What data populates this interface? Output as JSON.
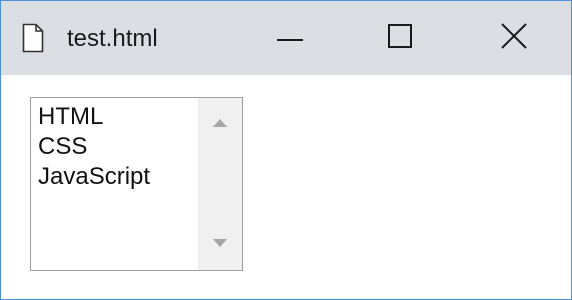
{
  "window": {
    "title": "test.html",
    "icons": {
      "document": "document-icon",
      "minimize": "minimize-icon",
      "maximize": "maximize-icon",
      "close": "close-icon"
    }
  },
  "listbox": {
    "options": [
      "HTML",
      "CSS",
      "JavaScript"
    ],
    "scrollbar": {
      "up_icon": "scroll-up-arrow-icon",
      "down_icon": "scroll-down-arrow-icon"
    }
  },
  "colors": {
    "titlebar_bg": "#dbdfe4",
    "window_border": "#4a90d9",
    "listbox_border": "#a0a0a0",
    "scrollbar_bg": "#f0f0f0"
  }
}
